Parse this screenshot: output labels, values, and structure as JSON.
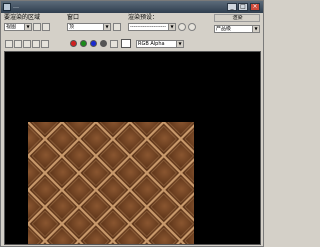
{
  "window": {
    "title": "…",
    "minimize": "_",
    "maximize": "□",
    "close": "×"
  },
  "panels": {
    "area_to_render": {
      "label": "要渲染的区域",
      "value": "视图"
    },
    "viewport": {
      "label": "窗口",
      "value": "顶"
    },
    "render_preset": {
      "label": "渲染预设：",
      "value": "--------------------"
    },
    "render_level": {
      "label": "渲染",
      "value": "产品级"
    }
  },
  "toolbar": {
    "channel_selector": {
      "value": "RGB Alpha"
    }
  },
  "colors": {
    "red_channel": "#d02020",
    "green_channel": "#1a8a1a",
    "blue_channel": "#1a2ad0",
    "alpha_channel": "#555555",
    "texture_dark": "#5a3217",
    "texture_mid": "#8a5630",
    "texture_light": "#c99a6c"
  }
}
